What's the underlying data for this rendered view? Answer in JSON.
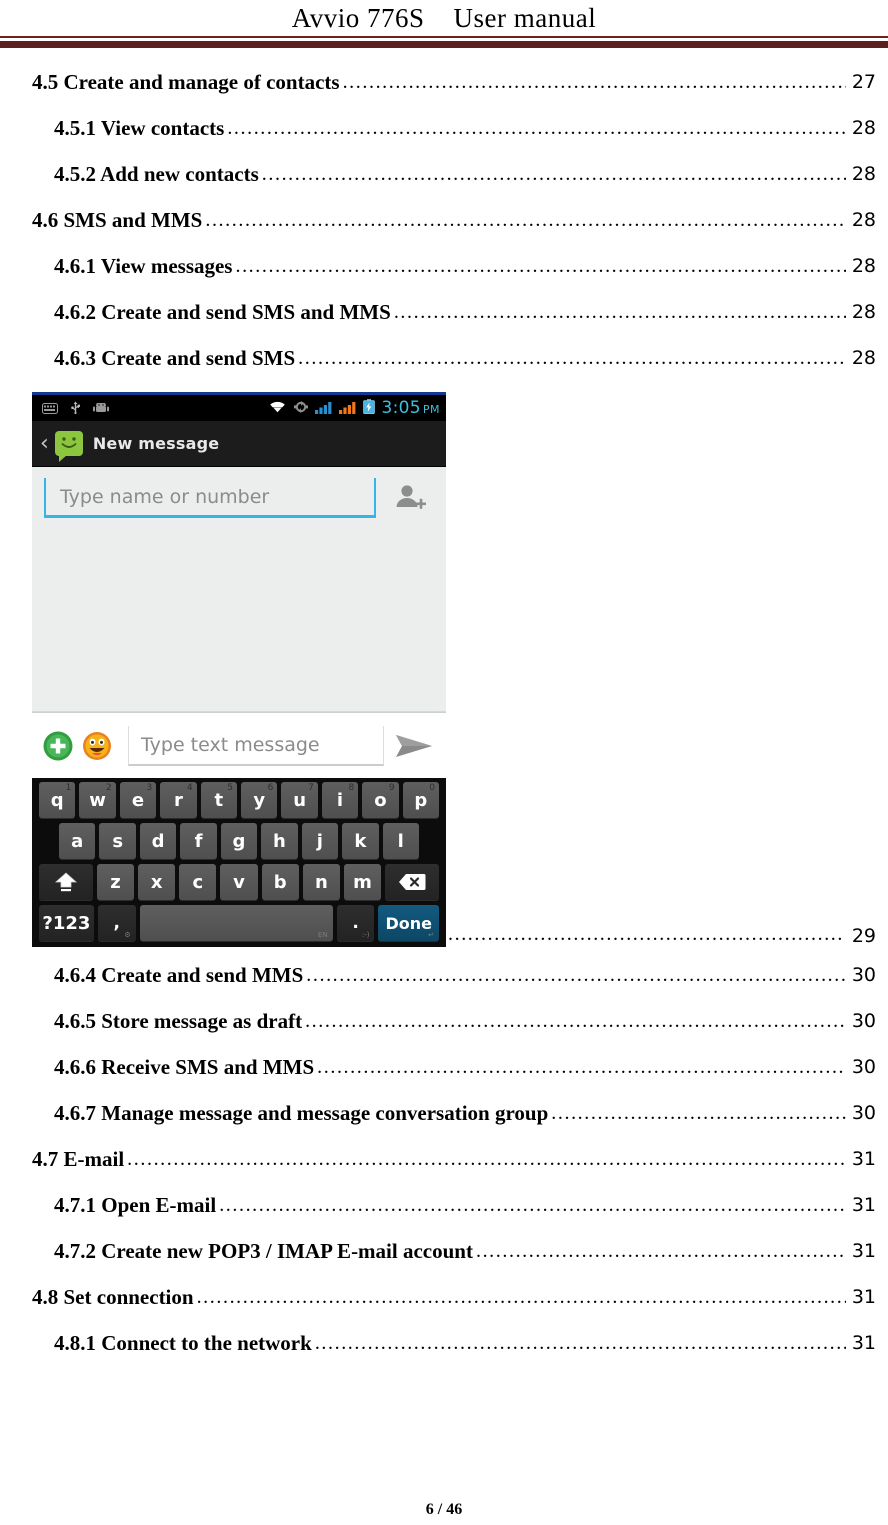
{
  "header": {
    "title": "Avvio 776S    User manual",
    "rule_color": "#5c1f1f"
  },
  "toc": {
    "entries": [
      {
        "label": "4.5 Create and manage of contacts",
        "page": "27",
        "level": 1
      },
      {
        "label": "4.5.1 View contacts",
        "page": "28",
        "level": 2
      },
      {
        "label": "4.5.2 Add new contacts",
        "page": "28",
        "level": 2
      },
      {
        "label": "4.6 SMS and MMS",
        "page": "28",
        "level": 1
      },
      {
        "label": "4.6.1 View messages",
        "page": "28",
        "level": 2
      },
      {
        "label": "4.6.2 Create and send SMS and MMS",
        "page": "28",
        "level": 2
      },
      {
        "label": "4.6.3 Create and send SMS",
        "page": "28",
        "level": 2
      }
    ],
    "entries_after_figure": [
      {
        "label": "4.6.4 Create and send MMS",
        "page": "30",
        "level": 2
      },
      {
        "label": "4.6.5 Store message as draft",
        "page": "30",
        "level": 2
      },
      {
        "label": "4.6.6 Receive SMS and MMS",
        "page": "30",
        "level": 2
      },
      {
        "label": "4.6.7 Manage message and message conversation group",
        "page": "30",
        "level": 2
      },
      {
        "label": "4.7 E-mail",
        "page": "31",
        "level": 1
      },
      {
        "label": "4.7.1 Open E-mail",
        "page": "31",
        "level": 2
      },
      {
        "label": "4.7.2 Create new POP3 / IMAP E-mail account",
        "page": "31",
        "level": 2
      },
      {
        "label": "4.8 Set connection",
        "page": "31",
        "level": 1
      },
      {
        "label": "4.8.1 Connect to the network",
        "page": "31",
        "level": 2
      }
    ]
  },
  "figure": {
    "page": "29",
    "phone": {
      "status_bar": {
        "clock_time": "3:05",
        "clock_ampm": "PM",
        "clock_color": "#3fbfdf",
        "left_icons": [
          "keyboard-icon",
          "usb-icon",
          "android-robot-icon"
        ],
        "right_icons": [
          "wifi-icon",
          "sync-icon",
          "signal-sim1-icon",
          "signal-sim2-icon",
          "battery-charging-icon"
        ],
        "signal_sim1_color": "#2a8fd0",
        "signal_sim2_color": "#f07818",
        "battery_color": "#4ab3e0"
      },
      "action_bar": {
        "title": "New message",
        "back_icon": "‹",
        "app_icon": "messaging-icon",
        "app_icon_color": "#8cc63e"
      },
      "recipient": {
        "placeholder": "Type name or number",
        "value": "",
        "underline_color": "#33b5e5",
        "add_contact_icon": "add-contact-icon"
      },
      "compose": {
        "placeholder": "Type text message",
        "value": "",
        "attach_icon": "plus-attach-icon",
        "emoji_icon": "smiley-emoji-icon",
        "send_icon": "send-arrow-icon"
      },
      "keyboard": {
        "row1": [
          {
            "key": "q",
            "hint": "1"
          },
          {
            "key": "w",
            "hint": "2"
          },
          {
            "key": "e",
            "hint": "3"
          },
          {
            "key": "r",
            "hint": "4"
          },
          {
            "key": "t",
            "hint": "5"
          },
          {
            "key": "y",
            "hint": "6"
          },
          {
            "key": "u",
            "hint": "7"
          },
          {
            "key": "i",
            "hint": "8"
          },
          {
            "key": "o",
            "hint": "9"
          },
          {
            "key": "p",
            "hint": "0"
          }
        ],
        "row2": [
          "a",
          "s",
          "d",
          "f",
          "g",
          "h",
          "j",
          "k",
          "l"
        ],
        "row3": [
          "z",
          "x",
          "c",
          "v",
          "b",
          "n",
          "m"
        ],
        "shift_label": "shift-key",
        "backspace_label": "backspace-key",
        "symbols_label": "?123",
        "comma_label": ",",
        "space_label": "",
        "period_label": ".",
        "done_label": "Done",
        "done_color": "#0d4765"
      }
    }
  },
  "footer": {
    "page_indicator": "6 / 46"
  }
}
